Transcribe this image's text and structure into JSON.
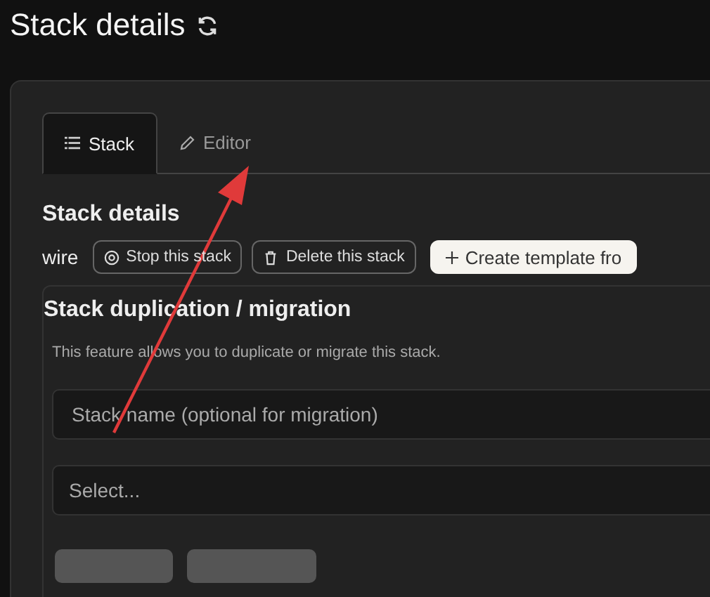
{
  "page": {
    "title": "Stack details"
  },
  "tabs": [
    {
      "label": "Stack",
      "selected": true
    },
    {
      "label": "Editor",
      "selected": false
    }
  ],
  "details": {
    "heading": "Stack details",
    "name": "wire",
    "actions": [
      {
        "label": "Stop this stack",
        "kind": "outline"
      },
      {
        "label": "Delete this stack",
        "kind": "outline"
      },
      {
        "label": "Create template fro",
        "kind": "light"
      }
    ]
  },
  "duplication": {
    "heading": "Stack duplication / migration",
    "description": "This feature allows you to duplicate or migrate this stack.",
    "name_field": {
      "placeholder": "Stack name (optional for migration)"
    },
    "select": {
      "placeholder": "Select..."
    }
  }
}
